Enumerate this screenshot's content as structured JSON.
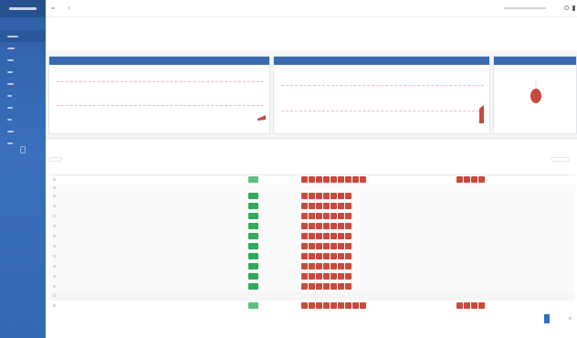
{
  "sidebar": {
    "brand": "",
    "items": [
      {
        "label": "",
        "active": true
      },
      {
        "label": ""
      },
      {
        "label": ""
      },
      {
        "label": ""
      },
      {
        "label": ""
      },
      {
        "label": ""
      },
      {
        "label": ""
      },
      {
        "label": ""
      },
      {
        "label": ""
      },
      {
        "label": ""
      }
    ]
  },
  "topbar": {
    "user_text": ""
  },
  "page": {
    "title": "",
    "subtitle": ""
  },
  "cards": [
    {
      "title": ""
    },
    {
      "title": ""
    },
    {
      "title": ""
    }
  ],
  "panel": {
    "title": "",
    "search_placeholder": "",
    "columns": [
      "",
      "",
      "",
      "",
      "",
      "",
      "",
      "",
      ""
    ]
  },
  "rows": [
    {
      "cells": [
        "",
        "",
        "",
        "",
        ""
      ],
      "type": "main",
      "status": "light",
      "chips_a": 9,
      "chips_b": 4
    },
    {
      "cells": [
        "",
        "",
        "",
        "",
        ""
      ],
      "type": "subhead"
    },
    {
      "cells": [
        "",
        "",
        "",
        "",
        ""
      ],
      "type": "sub",
      "status": "dark",
      "chips_a": 7
    },
    {
      "cells": [
        "",
        "",
        "",
        "",
        ""
      ],
      "type": "sub",
      "status": "dark",
      "chips_a": 7
    },
    {
      "cells": [
        "",
        "",
        "",
        "",
        ""
      ],
      "type": "sub",
      "status": "dark",
      "chips_a": 7
    },
    {
      "cells": [
        "",
        "",
        "",
        "",
        ""
      ],
      "type": "sub",
      "status": "dark",
      "chips_a": 7
    },
    {
      "cells": [
        "",
        "",
        "",
        "",
        ""
      ],
      "type": "sub",
      "status": "dark",
      "chips_a": 7
    },
    {
      "cells": [
        "",
        "",
        "",
        "",
        ""
      ],
      "type": "sub",
      "status": "dark",
      "chips_a": 7
    },
    {
      "cells": [
        "",
        "",
        "",
        "",
        ""
      ],
      "type": "sub",
      "status": "dark",
      "chips_a": 7
    },
    {
      "cells": [
        "",
        "",
        "",
        "",
        ""
      ],
      "type": "sub",
      "status": "dark",
      "chips_a": 7
    },
    {
      "cells": [
        "",
        "",
        "",
        "",
        ""
      ],
      "type": "sub",
      "status": "dark",
      "chips_a": 7
    },
    {
      "cells": [
        "",
        "",
        "",
        "",
        ""
      ],
      "type": "sub",
      "status": "dark",
      "chips_a": 7
    },
    {
      "cells": [
        "",
        "",
        "",
        "",
        ""
      ],
      "type": "footer"
    },
    {
      "cells": [
        "",
        "",
        "",
        "",
        ""
      ],
      "type": "main",
      "status": "light",
      "chips_a": 9,
      "chips_b": 4
    }
  ],
  "colors": {
    "sidebar": "#3468b4",
    "card_header": "#3a6aaf",
    "status_ok": "#2eaa58",
    "chip": "#c9493d",
    "chart_marker": "#c9493d"
  },
  "icons": [
    "menu-icon",
    "back-icon",
    "gear-icon",
    "more-icon"
  ]
}
